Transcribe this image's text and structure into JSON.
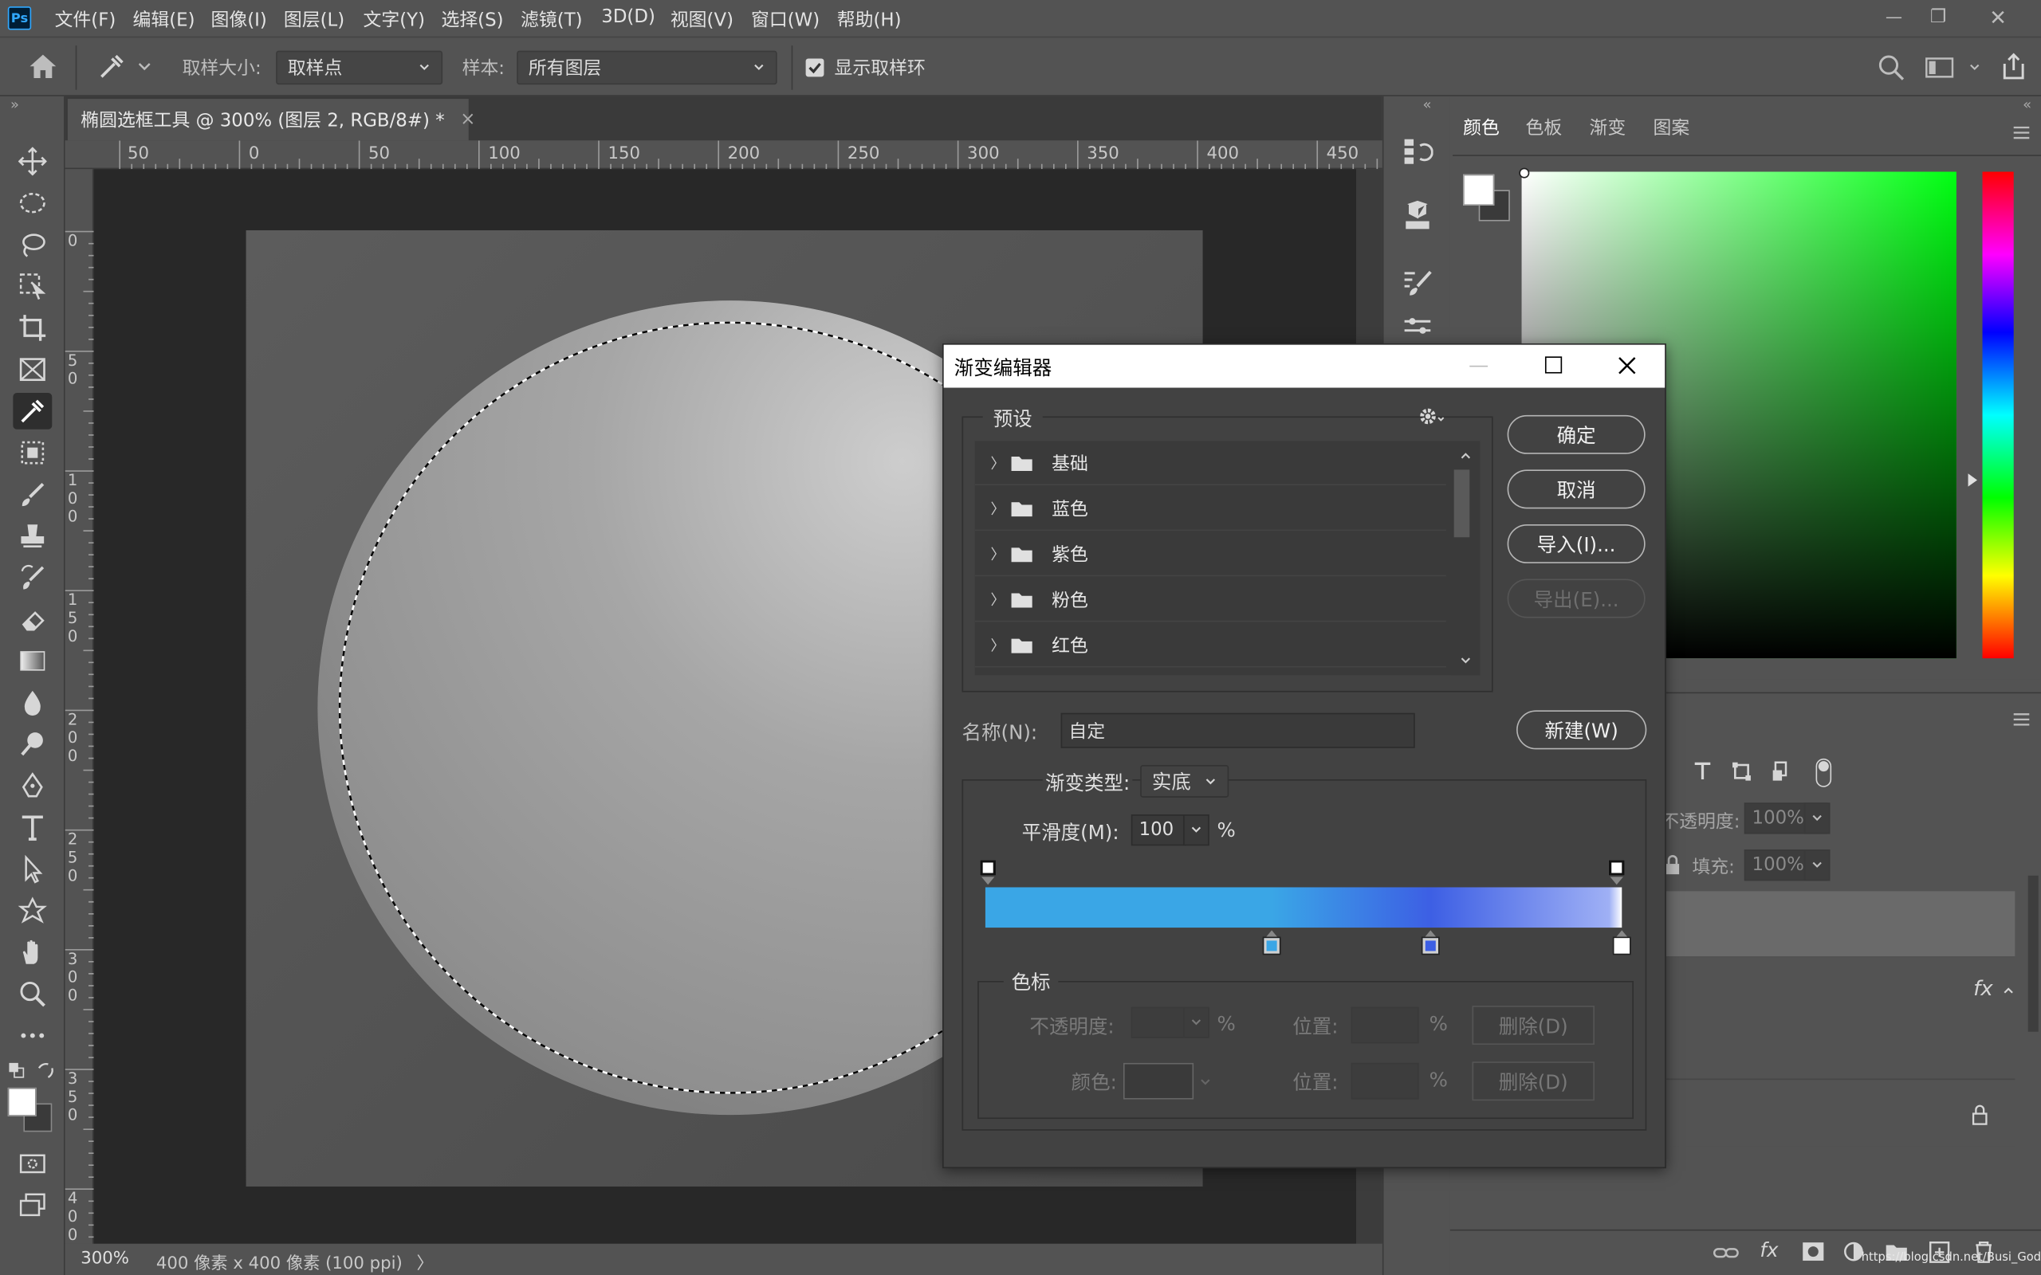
{
  "app": {
    "logo": "Ps"
  },
  "menubar": {
    "items": [
      "文件(F)",
      "编辑(E)",
      "图像(I)",
      "图层(L)",
      "文字(Y)",
      "选择(S)",
      "滤镜(T)",
      "3D(D)",
      "视图(V)",
      "窗口(W)",
      "帮助(H)"
    ]
  },
  "window_controls": {
    "minimize": "—",
    "restore": "❐",
    "close": "✕"
  },
  "options_bar": {
    "sample_size_label": "取样大小:",
    "sample_size_value": "取样点",
    "sample_label": "样本:",
    "sample_value": "所有图层",
    "show_ring_label": "显示取样环",
    "show_ring_checked": true
  },
  "document": {
    "tab_title": "椭圆选框工具 @ 300% (图层 2, RGB/8#) *",
    "tab_close": "×",
    "ruler_h": [
      "50",
      "0",
      "50",
      "100",
      "150",
      "200",
      "250",
      "300",
      "350",
      "400",
      "450"
    ],
    "ruler_v": [
      "0",
      "5\n0",
      "1\n0\n0",
      "1\n5\n0",
      "2\n0\n0",
      "2\n5\n0",
      "3\n0\n0",
      "3\n5\n0",
      "4\n0\n0"
    ],
    "zoom": "300%",
    "doc_info": "400 像素 x 400 像素 (100 ppi)",
    "status_arrow": "〉"
  },
  "color_panel": {
    "tabs": [
      "颜色",
      "色板",
      "渐变",
      "图案"
    ],
    "active_tab": "颜色"
  },
  "layers_panel": {
    "opacity_label": "不透明度:",
    "opacity_value": "100%",
    "fill_label": "填充:",
    "fill_value": "100%",
    "fx_label": "fx"
  },
  "watermark": "https://blog.csdn.net/Busi_Gods",
  "gradient_editor": {
    "title": "渐变编辑器",
    "presets_label": "预设",
    "preset_folders": [
      "基础",
      "蓝色",
      "紫色",
      "粉色",
      "红色"
    ],
    "buttons": {
      "ok": "确定",
      "cancel": "取消",
      "import": "导入(I)...",
      "export": "导出(E)...",
      "new": "新建(W)"
    },
    "name_label": "名称(N):",
    "name_value": "自定",
    "type_label": "渐变类型:",
    "type_value": "实底",
    "smoothness_label": "平滑度(M):",
    "smoothness_value": "100",
    "percent": "%",
    "gradient_colors": {
      "stop1": "#3aa6e6",
      "stop2": "#3d5fe4",
      "stop3": "#ffffff"
    },
    "color_stop_positions": [
      0.45,
      0.7,
      1.0
    ],
    "stops_section": {
      "label": "色标",
      "opacity_label": "不透明度:",
      "color_label": "颜色:",
      "location_label": "位置:",
      "delete_label": "删除(D)"
    }
  },
  "colors": {
    "accent": "#31a8ff",
    "panel_bg": "#535353",
    "dialog_bg": "#424242"
  }
}
